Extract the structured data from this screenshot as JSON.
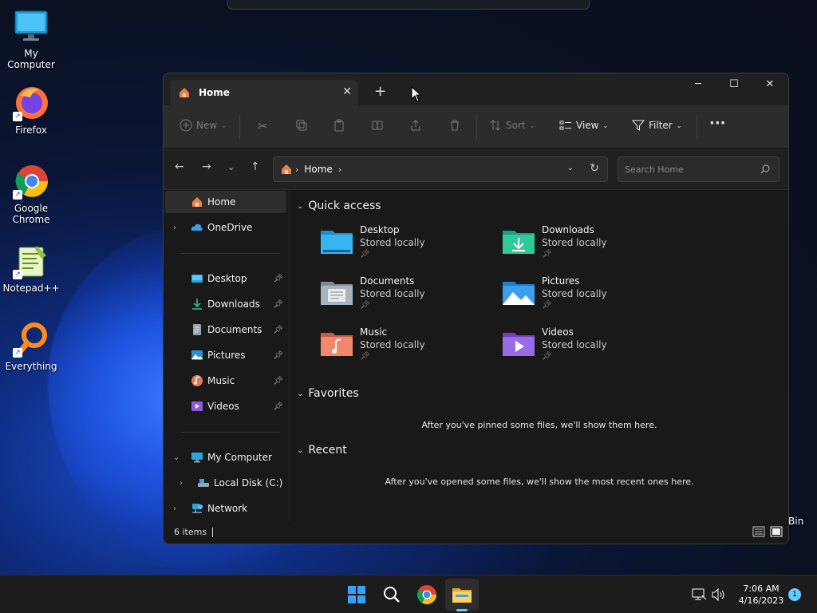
{
  "desktop": {
    "icons": [
      {
        "label": "My Computer"
      },
      {
        "label": "Firefox"
      },
      {
        "label": "Google Chrome"
      },
      {
        "label": "Notepad++"
      },
      {
        "label": "Everything"
      }
    ],
    "recycle_partial_label": "Bin"
  },
  "explorer": {
    "tab_title": "Home",
    "toolbar": {
      "new_label": "New",
      "sort_label": "Sort",
      "view_label": "View",
      "filter_label": "Filter"
    },
    "address": {
      "crumb": "Home"
    },
    "search": {
      "placeholder": "Search Home"
    },
    "sidebar": {
      "home": "Home",
      "onedrive": "OneDrive",
      "desktop": "Desktop",
      "downloads": "Downloads",
      "documents": "Documents",
      "pictures": "Pictures",
      "music": "Music",
      "videos": "Videos",
      "my_computer": "My Computer",
      "local_disk": "Local Disk (C:)",
      "network": "Network"
    },
    "sections": {
      "quick_access": "Quick access",
      "favorites": "Favorites",
      "recent": "Recent"
    },
    "quick_access": [
      {
        "name": "Desktop",
        "sub": "Stored locally"
      },
      {
        "name": "Downloads",
        "sub": "Stored locally"
      },
      {
        "name": "Documents",
        "sub": "Stored locally"
      },
      {
        "name": "Pictures",
        "sub": "Stored locally"
      },
      {
        "name": "Music",
        "sub": "Stored locally"
      },
      {
        "name": "Videos",
        "sub": "Stored locally"
      }
    ],
    "favorites_empty": "After you've pinned some files, we'll show them here.",
    "recent_empty": "After you've opened some files, we'll show the most recent ones here.",
    "status": {
      "items": "6 items"
    }
  },
  "taskbar": {
    "time": "7:06 AM",
    "date": "4/16/2023",
    "notification_count": "1"
  },
  "colors": {
    "accent": "#60cdff",
    "window_bg": "#191919",
    "toolbar_bg": "#2c2c2c"
  }
}
